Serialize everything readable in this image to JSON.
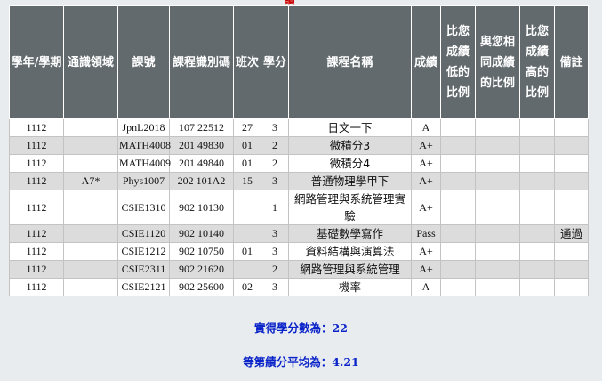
{
  "top_mark": "績",
  "headers": {
    "term": "學年/學期",
    "field": "通識領域",
    "course_no": "課號",
    "course_id": "課程識別碼",
    "class": "班次",
    "credits": "學分",
    "course_name": "課程名稱",
    "grade": "成績",
    "lower_ratio": "比您成績低的比例",
    "same_ratio": "與您相同成績的比例",
    "higher_ratio": "比您成績高的比例",
    "note": "備註"
  },
  "rows": [
    {
      "term": "1112",
      "field": "",
      "course_no": "JpnL2018",
      "course_id": "107 22512",
      "class": "27",
      "credits": "3",
      "course_name": "日文一下",
      "grade": "A",
      "lower": "",
      "same": "",
      "higher": "",
      "note": ""
    },
    {
      "term": "1112",
      "field": "",
      "course_no": "MATH4008",
      "course_id": "201 49830",
      "class": "01",
      "credits": "2",
      "course_name": "微積分3",
      "grade": "A+",
      "lower": "",
      "same": "",
      "higher": "",
      "note": ""
    },
    {
      "term": "1112",
      "field": "",
      "course_no": "MATH4009",
      "course_id": "201 49840",
      "class": "01",
      "credits": "2",
      "course_name": "微積分4",
      "grade": "A+",
      "lower": "",
      "same": "",
      "higher": "",
      "note": ""
    },
    {
      "term": "1112",
      "field": "A7*",
      "course_no": "Phys1007",
      "course_id": "202 101A2",
      "class": "15",
      "credits": "3",
      "course_name": "普通物理學甲下",
      "grade": "A+",
      "lower": "",
      "same": "",
      "higher": "",
      "note": ""
    },
    {
      "term": "1112",
      "field": "",
      "course_no": "CSIE1310",
      "course_id": "902 10130",
      "class": "",
      "credits": "1",
      "course_name": "網路管理與系統管理實驗",
      "grade": "A+",
      "lower": "",
      "same": "",
      "higher": "",
      "note": ""
    },
    {
      "term": "1112",
      "field": "",
      "course_no": "CSIE1120",
      "course_id": "902 10140",
      "class": "",
      "credits": "3",
      "course_name": "基礎數學寫作",
      "grade": "Pass",
      "lower": "",
      "same": "",
      "higher": "",
      "note": "通過"
    },
    {
      "term": "1112",
      "field": "",
      "course_no": "CSIE1212",
      "course_id": "902 10750",
      "class": "01",
      "credits": "3",
      "course_name": "資料結構與演算法",
      "grade": "A+",
      "lower": "",
      "same": "",
      "higher": "",
      "note": ""
    },
    {
      "term": "1112",
      "field": "",
      "course_no": "CSIE2311",
      "course_id": "902 21620",
      "class": "",
      "credits": "2",
      "course_name": "網路管理與系統管理",
      "grade": "A+",
      "lower": "",
      "same": "",
      "higher": "",
      "note": ""
    },
    {
      "term": "1112",
      "field": "",
      "course_no": "CSIE2121",
      "course_id": "902 25600",
      "class": "02",
      "credits": "3",
      "course_name": "機率",
      "grade": "A",
      "lower": "",
      "same": "",
      "higher": "",
      "note": ""
    }
  ],
  "summary": {
    "credits_label": "實得學分數為：",
    "credits_value": "22",
    "gpa_label": "等第績分平均為：",
    "gpa_value": "4.21"
  },
  "colors": {
    "header_bg": "#626a6e",
    "alt_row_bg": "#dcdcdc",
    "summary_text": "#0b24c9",
    "page_bg": "#e8ecef"
  }
}
